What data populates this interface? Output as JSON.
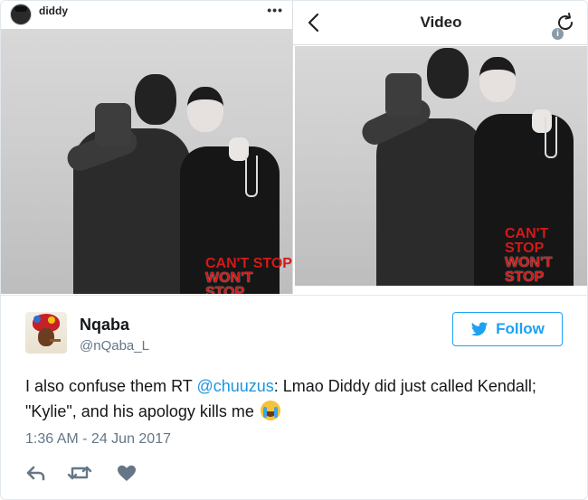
{
  "left_post": {
    "username": "diddy",
    "more_label": "•••",
    "photo_logo": {
      "line1": "CAN'T STOP",
      "line2": "WON'T STOP"
    }
  },
  "right_post": {
    "title": "Video",
    "back_icon": "chevron-left-icon",
    "refresh_icon": "refresh-icon",
    "info_badge": "i",
    "photo_logo": {
      "line1": "CAN'T STOP",
      "line2": "WON'T STOP"
    }
  },
  "tweet": {
    "name": "Nqaba",
    "handle": "@nQaba_L",
    "follow_label": "Follow",
    "text_before": "I also confuse them RT ",
    "mention": "@chuuzus",
    "text_after": ": Lmao Diddy did just called Kendall; \"Kylie\", and his apology kills me ",
    "emoji": "loudly-crying-face-emoji",
    "timestamp": "1:36 AM - 24 Jun 2017",
    "actions": [
      "reply-icon",
      "retweet-icon",
      "like-icon"
    ],
    "colors": {
      "link": "#1b95e0",
      "follow": "#1da1f2",
      "secondary": "#657786"
    }
  }
}
